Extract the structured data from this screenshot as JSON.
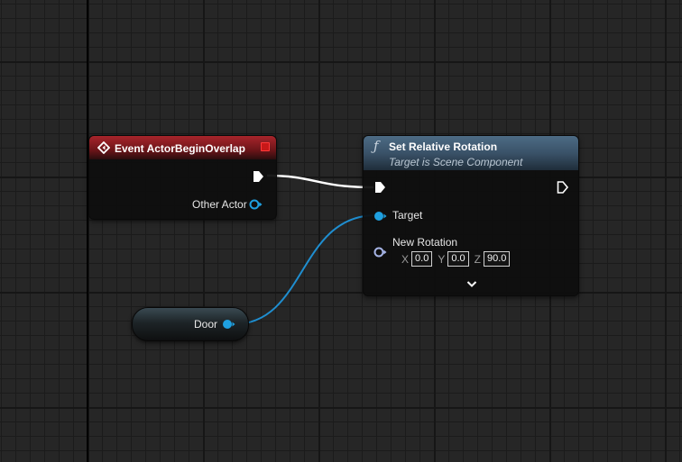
{
  "event_node": {
    "title": "Event ActorBeginOverlap",
    "output_pin_label": "Other Actor",
    "icon": "event-diamond-icon",
    "header_color": "#a8252b"
  },
  "function_node": {
    "title": "Set Relative Rotation",
    "subtitle": "Target is Scene Component",
    "icon": "function-f-icon",
    "header_color": "#4d6b85",
    "target_label": "Target",
    "new_rotation_label": "New Rotation",
    "rotation": {
      "x_label": "X",
      "x_value": "0.0",
      "y_label": "Y",
      "y_value": "0.0",
      "z_label": "Z",
      "z_value": "90.0"
    }
  },
  "variable_node": {
    "label": "Door",
    "pin_color": "#1fa0e0"
  },
  "colors": {
    "exec_wire": "#ffffff",
    "object_wire": "#1f8ed0",
    "grid_bg": "#262626"
  }
}
